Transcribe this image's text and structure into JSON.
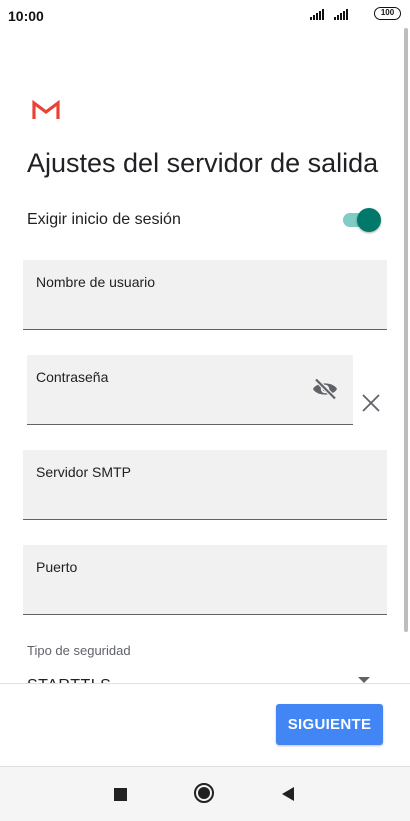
{
  "status_bar": {
    "time": "10:00",
    "battery": "100",
    "icons": [
      "signal-icon",
      "signal-icon",
      "battery-icon"
    ]
  },
  "app": {
    "logo_icon": "gmail-logo",
    "brand_color": "#EA4335"
  },
  "page": {
    "title": "Ajustes del servidor de salida"
  },
  "require_login": {
    "label": "Exigir inicio de sesión",
    "enabled": true,
    "accent_color": "#00796B"
  },
  "fields": {
    "username": {
      "label": "Nombre de usuario",
      "value": ""
    },
    "password": {
      "label": "Contraseña",
      "value": "",
      "toggle_icon": "eye-off-icon",
      "clear_icon": "close-icon"
    },
    "smtp_server": {
      "label": "Servidor SMTP",
      "value": ""
    },
    "port": {
      "label": "Puerto",
      "value": ""
    }
  },
  "security": {
    "label": "Tipo de seguridad",
    "value": "STARTTLS"
  },
  "actions": {
    "next_label": "SIGUIENTE",
    "next_color": "#4285F4"
  },
  "nav": {
    "icons": [
      "recents-icon",
      "home-icon",
      "back-icon"
    ]
  }
}
